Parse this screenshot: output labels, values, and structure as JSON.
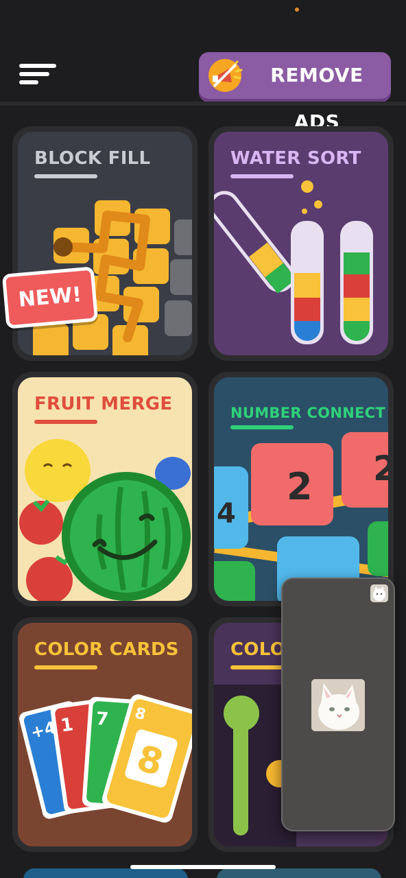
{
  "header": {
    "menu_icon": "hamburger-menu-icon",
    "remove_ads": {
      "label": "REMOVE ADS",
      "icon": "megaphone-no-ads-icon",
      "color": "#8b5ba3"
    }
  },
  "games": [
    {
      "title": "BLOCK FILL",
      "badge": "NEW!",
      "title_color": "#c9ccd3",
      "bg": "#3a3d45"
    },
    {
      "title": "WATER SORT",
      "title_color": "#d9b6f2",
      "bg": "#5a3c6f"
    },
    {
      "title": "FRUIT MERGE",
      "title_color": "#e04e3c",
      "bg": "#f7e3b0"
    },
    {
      "title": "NUMBER CONNECT",
      "title_color": "#2fd17a",
      "bg": "#2b4f66"
    },
    {
      "title": "COLOR CARDS",
      "title_color": "#f8c23a",
      "bg": "#7a4530"
    },
    {
      "title": "COLOR",
      "title_color": "#f8c23a",
      "bg": "#4a3358"
    }
  ],
  "pip_overlay": {
    "thumbnail_icon": "cat-thumbnail-icon",
    "image_icon": "cat-photo-icon"
  }
}
